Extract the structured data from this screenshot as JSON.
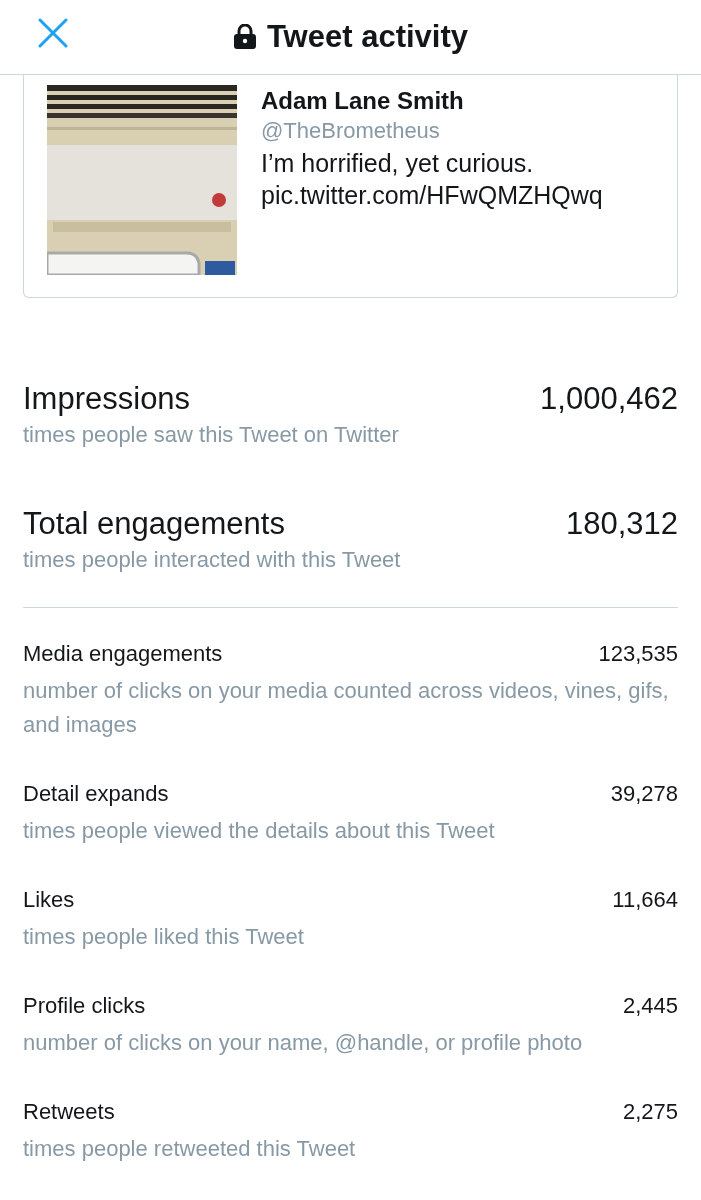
{
  "header": {
    "title": "Tweet activity"
  },
  "tweet": {
    "name": "Adam Lane Smith",
    "handle": "@TheBrometheus",
    "text": "I’m horrified, yet curious.",
    "link": "pic.twitter.com/HFwQMZHQwq"
  },
  "primary_metrics": [
    {
      "label": "Impressions",
      "value": "1,000,462",
      "description": "times people saw this Tweet on Twitter"
    },
    {
      "label": "Total engagements",
      "value": "180,312",
      "description": "times people interacted with this Tweet"
    }
  ],
  "metrics": [
    {
      "label": "Media engagements",
      "value": "123,535",
      "description": "number of clicks on your media counted across videos, vines, gifs, and images"
    },
    {
      "label": "Detail expands",
      "value": "39,278",
      "description": "times people viewed the details about this Tweet"
    },
    {
      "label": "Likes",
      "value": "11,664",
      "description": "times people liked this Tweet"
    },
    {
      "label": "Profile clicks",
      "value": "2,445",
      "description": "number of clicks on your name, @handle, or profile photo"
    },
    {
      "label": "Retweets",
      "value": "2,275",
      "description": "times people retweeted this Tweet"
    }
  ]
}
